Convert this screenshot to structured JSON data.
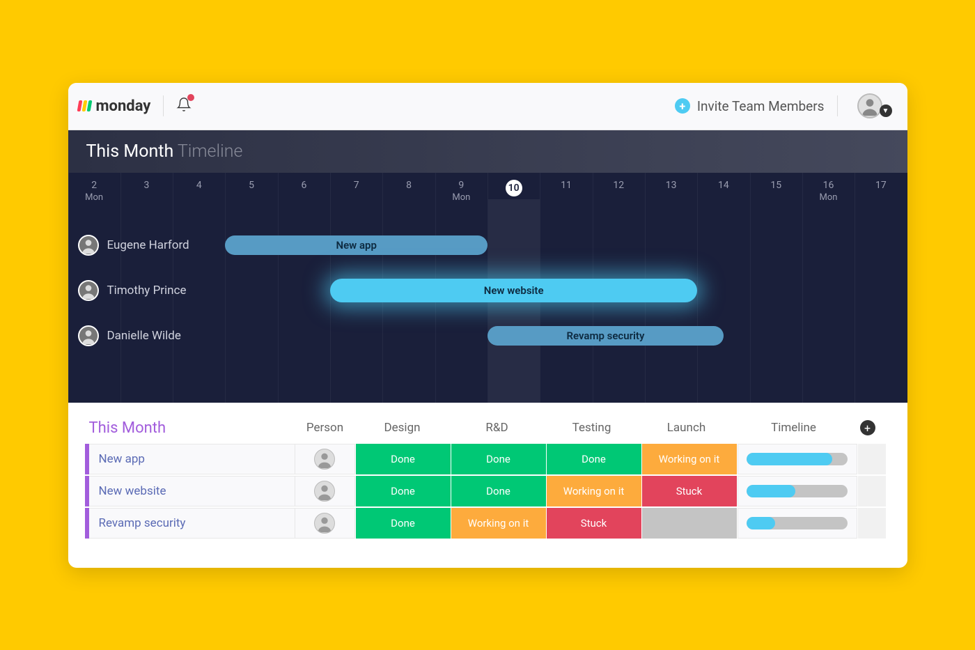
{
  "brand": "monday",
  "topbar": {
    "invite_label": "Invite Team Members"
  },
  "timeline_header": {
    "strong": "This Month",
    "light": "Timeline"
  },
  "days": [
    {
      "num": "2",
      "dow": "Mon"
    },
    {
      "num": "3",
      "dow": ""
    },
    {
      "num": "4",
      "dow": ""
    },
    {
      "num": "5",
      "dow": ""
    },
    {
      "num": "6",
      "dow": ""
    },
    {
      "num": "7",
      "dow": ""
    },
    {
      "num": "8",
      "dow": ""
    },
    {
      "num": "9",
      "dow": "Mon"
    },
    {
      "num": "10",
      "dow": "",
      "today": true
    },
    {
      "num": "11",
      "dow": ""
    },
    {
      "num": "12",
      "dow": ""
    },
    {
      "num": "13",
      "dow": ""
    },
    {
      "num": "14",
      "dow": ""
    },
    {
      "num": "15",
      "dow": ""
    },
    {
      "num": "16",
      "dow": "Mon"
    },
    {
      "num": "17",
      "dow": ""
    }
  ],
  "timeline_rows": [
    {
      "user": "Eugene Harford",
      "bar": {
        "label": "New app",
        "start": 3,
        "end": 7,
        "style": "blue"
      }
    },
    {
      "user": "Timothy Prince",
      "bar": {
        "label": "New website",
        "start": 5,
        "end": 11,
        "style": "bright"
      }
    },
    {
      "user": "Danielle Wilde",
      "bar": {
        "label": "Revamp security",
        "start": 8,
        "end": 11.5,
        "style": "blue"
      }
    }
  ],
  "table": {
    "group_title": "This Month",
    "columns": [
      "Person",
      "Design",
      "R&D",
      "Testing",
      "Launch",
      "Timeline"
    ],
    "rows": [
      {
        "name": "New app",
        "statuses": [
          "Done",
          "Done",
          "Done",
          "Working on it"
        ],
        "progress_left": 0,
        "progress_width": 85
      },
      {
        "name": "New website",
        "statuses": [
          "Done",
          "Done",
          "Working on it",
          "Stuck"
        ],
        "progress_left": 0,
        "progress_width": 48
      },
      {
        "name": "Revamp security",
        "statuses": [
          "Done",
          "Working on it",
          "Stuck",
          ""
        ],
        "progress_left": 0,
        "progress_width": 28
      }
    ]
  },
  "status_styles": {
    "Done": "status-done",
    "Working on it": "status-working",
    "Stuck": "status-stuck",
    "": "status-empty"
  }
}
